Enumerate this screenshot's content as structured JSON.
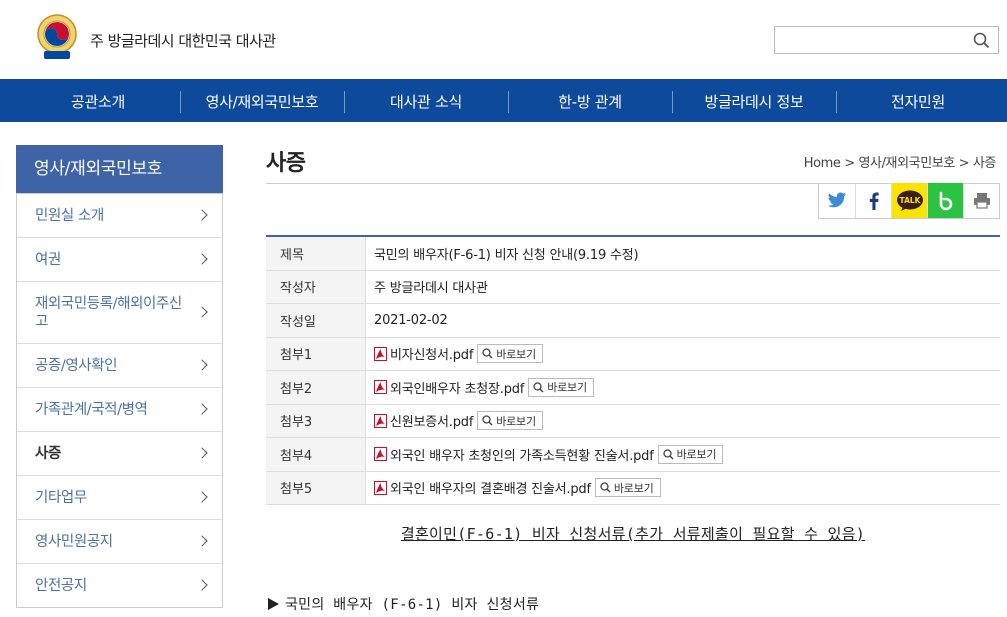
{
  "header": {
    "site_title": "주 방글라데시 대한민국 대사관",
    "search_placeholder": "",
    "search_value": ""
  },
  "gnb": [
    {
      "label": "공관소개"
    },
    {
      "label": "영사/재외국민보호"
    },
    {
      "label": "대사관 소식"
    },
    {
      "label": "한-방 관계"
    },
    {
      "label": "방글라데시 정보"
    },
    {
      "label": "전자민원"
    }
  ],
  "lnb": {
    "title": "영사/재외국민보호",
    "items": [
      {
        "label": "민원실 소개"
      },
      {
        "label": "여권"
      },
      {
        "label": "재외국민등록/해외이주신고"
      },
      {
        "label": "공증/영사확인"
      },
      {
        "label": "가족관계/국적/병역"
      },
      {
        "label": "사증",
        "active": true
      },
      {
        "label": "기타업무"
      },
      {
        "label": "영사민원공지"
      },
      {
        "label": "안전공지"
      }
    ]
  },
  "page": {
    "title": "사증",
    "breadcrumb": "Home > 영사/재외국민보호 > 사증"
  },
  "share": [
    {
      "icon": "twitter-icon"
    },
    {
      "icon": "facebook-icon"
    },
    {
      "icon": "kakaotalk-icon",
      "label": "TALK"
    },
    {
      "icon": "band-icon"
    },
    {
      "icon": "print-icon"
    }
  ],
  "post": {
    "subject_label": "제목",
    "subject": "국민의 배우자(F-6-1) 비자 신청 안내(9.19 수정)",
    "author_label": "작성자",
    "author": "주 방글라데시 대사관",
    "date_label": "작성일",
    "date": "2021-02-02",
    "preview_label": "바로보기",
    "attachments": [
      {
        "label": "첨부1",
        "file": "비자신청서.pdf"
      },
      {
        "label": "첨부2",
        "file": "외국인배우자 초청장.pdf"
      },
      {
        "label": "첨부3",
        "file": "신원보증서.pdf"
      },
      {
        "label": "첨부4",
        "file": "외국인 배우자 초청인의 가족소득현황 진술서.pdf"
      },
      {
        "label": "첨부5",
        "file": "외국인 배우자의 결혼배경 진술서.pdf"
      }
    ]
  },
  "body": {
    "doc_link": "결혼이민(F-6-1) 비자 신청서류(추가 서류제출이 필요할 수 있음)",
    "section_heading": "국민의 배우자 (F-6-1) 비자 신청서류"
  },
  "colors": {
    "nav_bg": "#0e4a9c",
    "sidebar_title_bg": "#3e63a6",
    "sidebar_link": "#4d72a8",
    "kakao": "#fbe300",
    "band": "#2bc341"
  }
}
